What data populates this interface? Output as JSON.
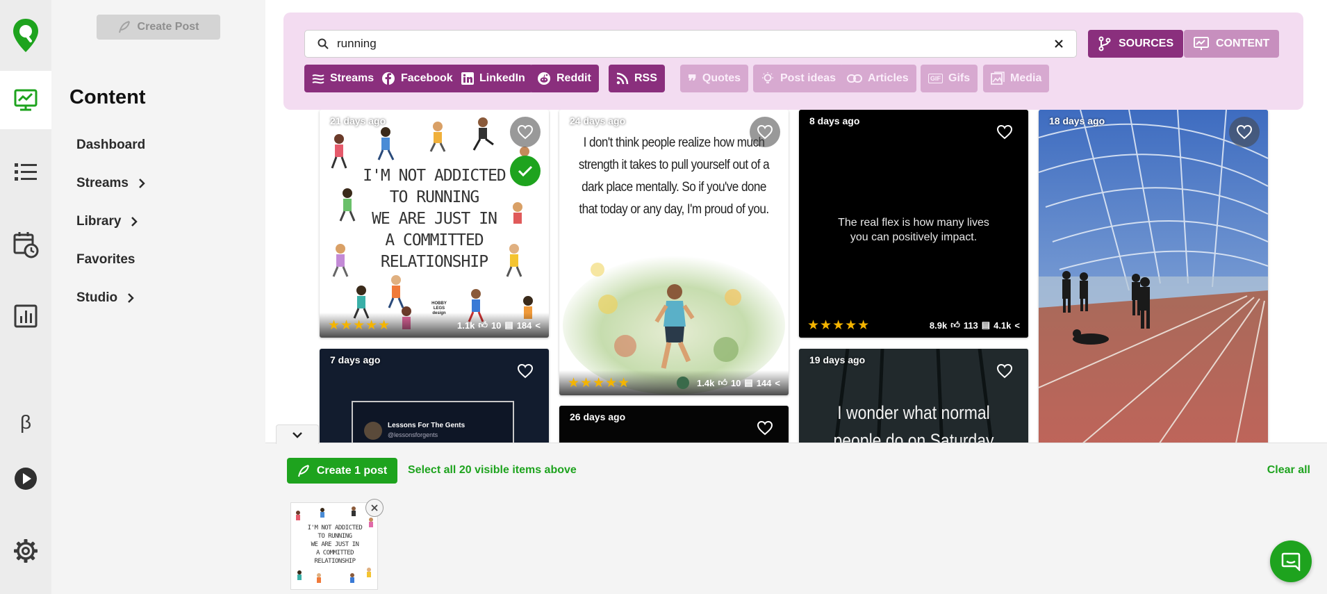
{
  "sidebar": {
    "create_post_label": "Create Post",
    "title": "Content",
    "items": [
      {
        "label": "Dashboard",
        "has_chevron": false
      },
      {
        "label": "Streams",
        "has_chevron": true
      },
      {
        "label": "Library",
        "has_chevron": true
      },
      {
        "label": "Favorites",
        "has_chevron": false
      },
      {
        "label": "Studio",
        "has_chevron": true
      }
    ]
  },
  "rail": {
    "icons": [
      "logo-pin-icon",
      "content-icon",
      "list-icon",
      "calendar-clock-icon",
      "bar-chart-icon",
      "beta-icon",
      "play-icon",
      "gear-icon"
    ],
    "beta_glyph": "β"
  },
  "search": {
    "value": "running",
    "sources_label": "SOURCES",
    "content_label": "CONTENT"
  },
  "chips": [
    {
      "label": "Streams",
      "state": "on",
      "icon": "streams-icon"
    },
    {
      "label": "Facebook",
      "state": "on",
      "icon": "facebook-icon"
    },
    {
      "label": "LinkedIn",
      "state": "on",
      "icon": "linkedin-icon"
    },
    {
      "label": "Reddit",
      "state": "on",
      "icon": "reddit-icon"
    },
    {
      "label": "RSS",
      "state": "on",
      "icon": "rss-icon"
    },
    {
      "label": "Quotes",
      "state": "off",
      "icon": "quote-icon"
    },
    {
      "label": "Post ideas",
      "state": "off",
      "icon": "lightbulb-icon"
    },
    {
      "label": "Articles",
      "state": "off",
      "icon": "link-icon"
    },
    {
      "label": "Gifs",
      "state": "off",
      "icon": "gif-icon"
    },
    {
      "label": "Media",
      "state": "off",
      "icon": "image-icon"
    }
  ],
  "cards": [
    {
      "age": "21 days ago",
      "selected": true,
      "rating": "★★★★★",
      "quote_lines": [
        "I'M NOT ADDICTED",
        "TO RUNNING",
        "WE ARE JUST IN",
        "A COMMITTED",
        "RELATIONSHIP"
      ],
      "brand": "HOBBY LEGS design",
      "likes": "1.1k",
      "comments": "10",
      "shares": "184"
    },
    {
      "age": "24 days ago",
      "selected": false,
      "rating": "★★★★★",
      "quote_lines": [
        "I don't think people realize how much",
        "strength it takes to pull yourself out of a",
        "dark place mentally. So if you've done",
        "that today or any day, I'm proud of you."
      ],
      "likes": "1.4k",
      "comments": "10",
      "shares": "144"
    },
    {
      "age": "8 days ago",
      "selected": false,
      "rating": "★★★★★",
      "quote_lines": [
        "The real flex is how many lives",
        "you can positively impact."
      ],
      "likes": "8.9k",
      "comments": "113",
      "shares": "4.1k"
    },
    {
      "age": "18 days ago",
      "selected": false
    },
    {
      "age": "7 days ago",
      "selected": false,
      "embed_title": "Lessons For The Gents",
      "embed_handle": "@lessonsforgents"
    },
    {
      "age": "26 days ago",
      "selected": false
    },
    {
      "age": "19 days ago",
      "selected": false,
      "quote_lines": [
        "I wonder what normal",
        "people do on Saturday"
      ]
    }
  ],
  "tray": {
    "create_label": "Create 1 post",
    "select_all_label": "Select all 20 visible items above",
    "clear_all_label": "Clear all",
    "thumb_lines": [
      "I'M NOT ADDICTED",
      "TO RUNNING",
      "WE ARE JUST IN",
      "A COMMITTED",
      "RELATIONSHIP"
    ]
  },
  "colors": {
    "brand_green": "#1ea31e",
    "accent_purple": "#8a2f7d",
    "panel_pink": "#f3dcf1"
  }
}
